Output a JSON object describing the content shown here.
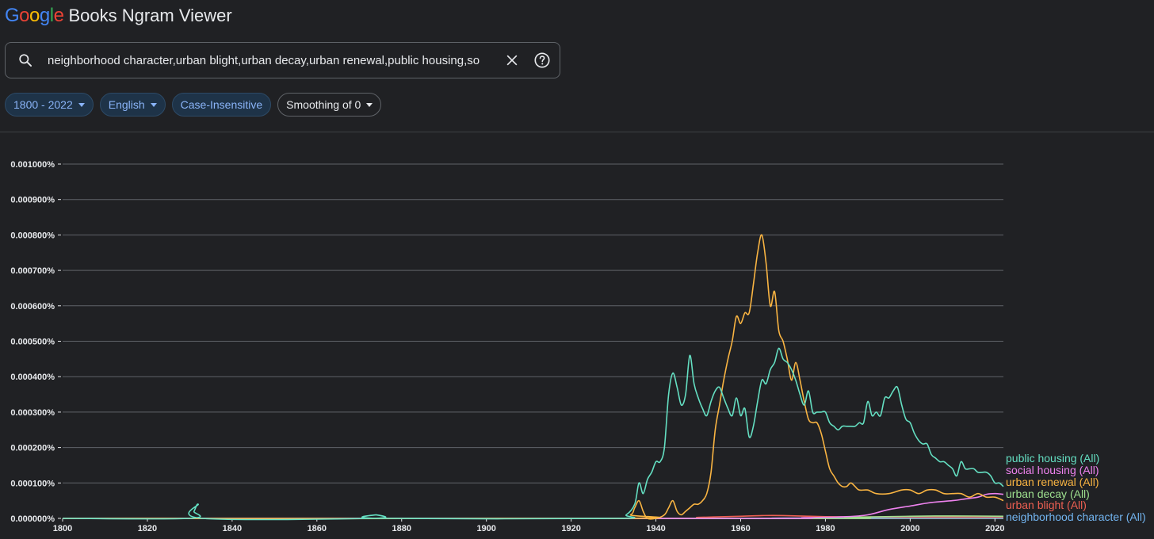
{
  "header": {
    "logo_letters": [
      {
        "ch": "G",
        "color": "#4285f4"
      },
      {
        "ch": "o",
        "color": "#ea4335"
      },
      {
        "ch": "o",
        "color": "#fbbc05"
      },
      {
        "ch": "g",
        "color": "#4285f4"
      },
      {
        "ch": "l",
        "color": "#34a853"
      },
      {
        "ch": "e",
        "color": "#ea4335"
      }
    ],
    "app_title": "Books Ngram Viewer"
  },
  "search": {
    "value": "neighborhood character,urban blight,urban decay,urban renewal,public housing,so",
    "icons": [
      "search-icon",
      "close-icon",
      "help-icon"
    ]
  },
  "filters": {
    "year_range": "1800 - 2022",
    "corpus": "English",
    "case": "Case-Insensitive",
    "smoothing": "Smoothing of 0"
  },
  "chart_data": {
    "type": "line",
    "x_range": [
      1800,
      2022
    ],
    "y_range": [
      0,
      0.001
    ],
    "y_unit": "%",
    "grid": true,
    "legend_placement": "right",
    "y_ticks": [
      "0.000000%",
      "0.000100%",
      "0.000200%",
      "0.000300%",
      "0.000400%",
      "0.000500%",
      "0.000600%",
      "0.000700%",
      "0.000800%",
      "0.000900%",
      "0.001000%"
    ],
    "x_ticks": [
      "1800",
      "1820",
      "1840",
      "1860",
      "1880",
      "1900",
      "1920",
      "1940",
      "1960",
      "1980",
      "2000",
      "2020"
    ],
    "series": [
      {
        "name": "public housing (All)",
        "color": "#64dfc2",
        "points": [
          [
            1800,
            0
          ],
          [
            1830,
            0
          ],
          [
            1831,
            2e-05
          ],
          [
            1832,
            4e-05
          ],
          [
            1833,
            0
          ],
          [
            1873,
            0
          ],
          [
            1874,
            1e-05
          ],
          [
            1875,
            0
          ],
          [
            1930,
            0
          ],
          [
            1933,
            1e-05
          ],
          [
            1935,
            4e-05
          ],
          [
            1936,
            0.0001
          ],
          [
            1937,
            7e-05
          ],
          [
            1938,
            0.00011
          ],
          [
            1939,
            0.00013
          ],
          [
            1940,
            0.00016
          ],
          [
            1941,
            0.00016
          ],
          [
            1942,
            0.0002
          ],
          [
            1943,
            0.00035
          ],
          [
            1944,
            0.00041
          ],
          [
            1945,
            0.00037
          ],
          [
            1946,
            0.00032
          ],
          [
            1947,
            0.00035
          ],
          [
            1948,
            0.00046
          ],
          [
            1949,
            0.00038
          ],
          [
            1950,
            0.00034
          ],
          [
            1951,
            0.00031
          ],
          [
            1952,
            0.00029
          ],
          [
            1953,
            0.00033
          ],
          [
            1954,
            0.00036
          ],
          [
            1955,
            0.00037
          ],
          [
            1956,
            0.00034
          ],
          [
            1957,
            0.00031
          ],
          [
            1958,
            0.00029
          ],
          [
            1959,
            0.00034
          ],
          [
            1960,
            0.00029
          ],
          [
            1961,
            0.00031
          ],
          [
            1962,
            0.00023
          ],
          [
            1963,
            0.00026
          ],
          [
            1964,
            0.00033
          ],
          [
            1965,
            0.00039
          ],
          [
            1966,
            0.00038
          ],
          [
            1967,
            0.00042
          ],
          [
            1968,
            0.00044
          ],
          [
            1969,
            0.00048
          ],
          [
            1970,
            0.00045
          ],
          [
            1971,
            0.00044
          ],
          [
            1972,
            0.00042
          ],
          [
            1973,
            0.00039
          ],
          [
            1974,
            0.00035
          ],
          [
            1975,
            0.00032
          ],
          [
            1976,
            0.00036
          ],
          [
            1977,
            0.0003
          ],
          [
            1978,
            0.0003
          ],
          [
            1979,
            0.0003
          ],
          [
            1980,
            0.0003
          ],
          [
            1981,
            0.00027
          ],
          [
            1982,
            0.00026
          ],
          [
            1983,
            0.00025
          ],
          [
            1984,
            0.00026
          ],
          [
            1985,
            0.00026
          ],
          [
            1986,
            0.00026
          ],
          [
            1987,
            0.00026
          ],
          [
            1988,
            0.00027
          ],
          [
            1989,
            0.00027
          ],
          [
            1990,
            0.00033
          ],
          [
            1991,
            0.00029
          ],
          [
            1992,
            0.0003
          ],
          [
            1993,
            0.00029
          ],
          [
            1994,
            0.00034
          ],
          [
            1995,
            0.00034
          ],
          [
            1996,
            0.00036
          ],
          [
            1997,
            0.00037
          ],
          [
            1998,
            0.00032
          ],
          [
            1999,
            0.00028
          ],
          [
            2000,
            0.00027
          ],
          [
            2001,
            0.00024
          ],
          [
            2002,
            0.00022
          ],
          [
            2003,
            0.00021
          ],
          [
            2004,
            0.00021
          ],
          [
            2005,
            0.00018
          ],
          [
            2006,
            0.00017
          ],
          [
            2007,
            0.00016
          ],
          [
            2008,
            0.00016
          ],
          [
            2009,
            0.00015
          ],
          [
            2010,
            0.00014
          ],
          [
            2011,
            0.00012
          ],
          [
            2012,
            0.00016
          ],
          [
            2013,
            0.00014
          ],
          [
            2014,
            0.00014
          ],
          [
            2015,
            0.00014
          ],
          [
            2016,
            0.00013
          ],
          [
            2017,
            0.00013
          ],
          [
            2018,
            0.00013
          ],
          [
            2019,
            0.00012
          ],
          [
            2020,
            0.0001
          ],
          [
            2021,
            0.0001
          ],
          [
            2022,
            9e-05
          ]
        ]
      },
      {
        "name": "social housing (All)",
        "color": "#ee82ee",
        "points": [
          [
            1800,
            0
          ],
          [
            1960,
            0
          ],
          [
            1975,
            2e-06
          ],
          [
            1985,
            5e-06
          ],
          [
            1990,
            1e-05
          ],
          [
            1995,
            2.5e-05
          ],
          [
            2000,
            3.5e-05
          ],
          [
            2005,
            4.5e-05
          ],
          [
            2010,
            5e-05
          ],
          [
            2013,
            5.5e-05
          ],
          [
            2016,
            6e-05
          ],
          [
            2018,
            6.8e-05
          ],
          [
            2020,
            7e-05
          ],
          [
            2022,
            6.8e-05
          ]
        ]
      },
      {
        "name": "urban renewal (All)",
        "color": "#f9b442",
        "points": [
          [
            1800,
            0
          ],
          [
            1930,
            0
          ],
          [
            1934,
            1e-05
          ],
          [
            1935,
            3e-05
          ],
          [
            1936,
            5e-05
          ],
          [
            1937,
            2e-05
          ],
          [
            1938,
            0
          ],
          [
            1940,
            0
          ],
          [
            1942,
            1e-05
          ],
          [
            1943,
            3e-05
          ],
          [
            1944,
            5e-05
          ],
          [
            1945,
            2e-05
          ],
          [
            1946,
            1e-05
          ],
          [
            1947,
            2e-05
          ],
          [
            1948,
            3e-05
          ],
          [
            1949,
            4e-05
          ],
          [
            1950,
            4e-05
          ],
          [
            1951,
            5e-05
          ],
          [
            1952,
            7e-05
          ],
          [
            1953,
            0.00013
          ],
          [
            1954,
            0.00025
          ],
          [
            1955,
            0.00032
          ],
          [
            1956,
            0.00039
          ],
          [
            1957,
            0.00045
          ],
          [
            1958,
            0.0005
          ],
          [
            1959,
            0.00057
          ],
          [
            1960,
            0.00055
          ],
          [
            1961,
            0.00058
          ],
          [
            1962,
            0.00058
          ],
          [
            1963,
            0.00066
          ],
          [
            1964,
            0.00075
          ],
          [
            1965,
            0.0008
          ],
          [
            1966,
            0.00072
          ],
          [
            1967,
            0.0006
          ],
          [
            1968,
            0.00064
          ],
          [
            1969,
            0.00053
          ],
          [
            1970,
            0.0005
          ],
          [
            1971,
            0.00045
          ],
          [
            1972,
            0.00039
          ],
          [
            1973,
            0.00044
          ],
          [
            1974,
            0.00039
          ],
          [
            1975,
            0.00033
          ],
          [
            1976,
            0.00028
          ],
          [
            1977,
            0.00027
          ],
          [
            1978,
            0.00027
          ],
          [
            1979,
            0.00024
          ],
          [
            1980,
            0.00019
          ],
          [
            1981,
            0.00014
          ],
          [
            1982,
            0.00012
          ],
          [
            1983,
            0.0001
          ],
          [
            1984,
            9e-05
          ],
          [
            1985,
            9e-05
          ],
          [
            1986,
            0.0001
          ],
          [
            1987,
            9e-05
          ],
          [
            1988,
            8e-05
          ],
          [
            1990,
            8e-05
          ],
          [
            1992,
            7e-05
          ],
          [
            1995,
            7e-05
          ],
          [
            1998,
            8e-05
          ],
          [
            2000,
            8e-05
          ],
          [
            2002,
            7e-05
          ],
          [
            2004,
            8e-05
          ],
          [
            2006,
            8e-05
          ],
          [
            2008,
            7e-05
          ],
          [
            2010,
            7e-05
          ],
          [
            2012,
            7e-05
          ],
          [
            2014,
            6e-05
          ],
          [
            2016,
            7e-05
          ],
          [
            2018,
            6e-05
          ],
          [
            2020,
            6e-05
          ],
          [
            2022,
            5e-05
          ]
        ]
      },
      {
        "name": "urban decay (All)",
        "color": "#9ee08f",
        "points": [
          [
            1800,
            0
          ],
          [
            1975,
            0
          ],
          [
            1985,
            3e-06
          ],
          [
            2000,
            6e-06
          ],
          [
            2010,
            7e-06
          ],
          [
            2022,
            6e-06
          ]
        ]
      },
      {
        "name": "urban blight (All)",
        "color": "#ec5f52",
        "points": [
          [
            1800,
            0
          ],
          [
            1940,
            0
          ],
          [
            1950,
            3e-06
          ],
          [
            1960,
            6e-06
          ],
          [
            1965,
            8e-06
          ],
          [
            1970,
            8e-06
          ],
          [
            1980,
            5e-06
          ],
          [
            1990,
            4e-06
          ],
          [
            2000,
            4e-06
          ],
          [
            2010,
            4e-06
          ],
          [
            2022,
            4e-06
          ]
        ]
      },
      {
        "name": "neighborhood character (All)",
        "color": "#72b4ef",
        "points": [
          [
            1800,
            0
          ],
          [
            1950,
            0
          ],
          [
            1970,
            1e-06
          ],
          [
            2000,
            2e-06
          ],
          [
            2022,
            2e-06
          ]
        ]
      }
    ]
  }
}
